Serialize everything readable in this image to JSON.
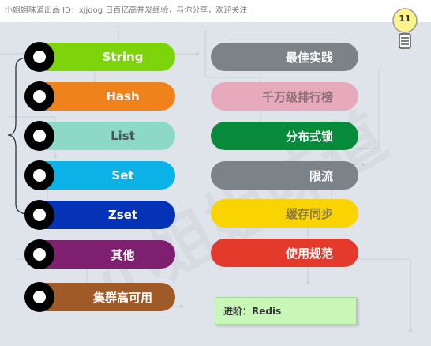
{
  "header": {
    "text": "小姐姐味道出品 ID：xjjdog  日百亿高并发经验，与你分享，欢迎关注"
  },
  "badge": {
    "number": "11"
  },
  "watermark": {
    "text": "小姐姐味道"
  },
  "data_structures": [
    {
      "label": "String",
      "color": "#7ed40a"
    },
    {
      "label": "Hash",
      "color": "#f0821c"
    },
    {
      "label": "List",
      "color": "#8dd8c6"
    },
    {
      "label": "Set",
      "color": "#0ab2e8"
    },
    {
      "label": "Zset",
      "color": "#0533b8"
    },
    {
      "label": "其他",
      "color": "#7f1f6f"
    },
    {
      "label": "集群高可用",
      "color": "#a05a28"
    }
  ],
  "topics": [
    {
      "label": "最佳实践",
      "color": "#7b8288"
    },
    {
      "label": "千万级排行榜",
      "color": "#e7a9bc"
    },
    {
      "label": "分布式锁",
      "color": "#078a3a"
    },
    {
      "label": "限流",
      "color": "#7b8288"
    },
    {
      "label": "缓存同步",
      "color": "#f9d400"
    },
    {
      "label": "使用规范",
      "color": "#e33a2b"
    }
  ],
  "note": {
    "text": "进阶：Redis"
  }
}
